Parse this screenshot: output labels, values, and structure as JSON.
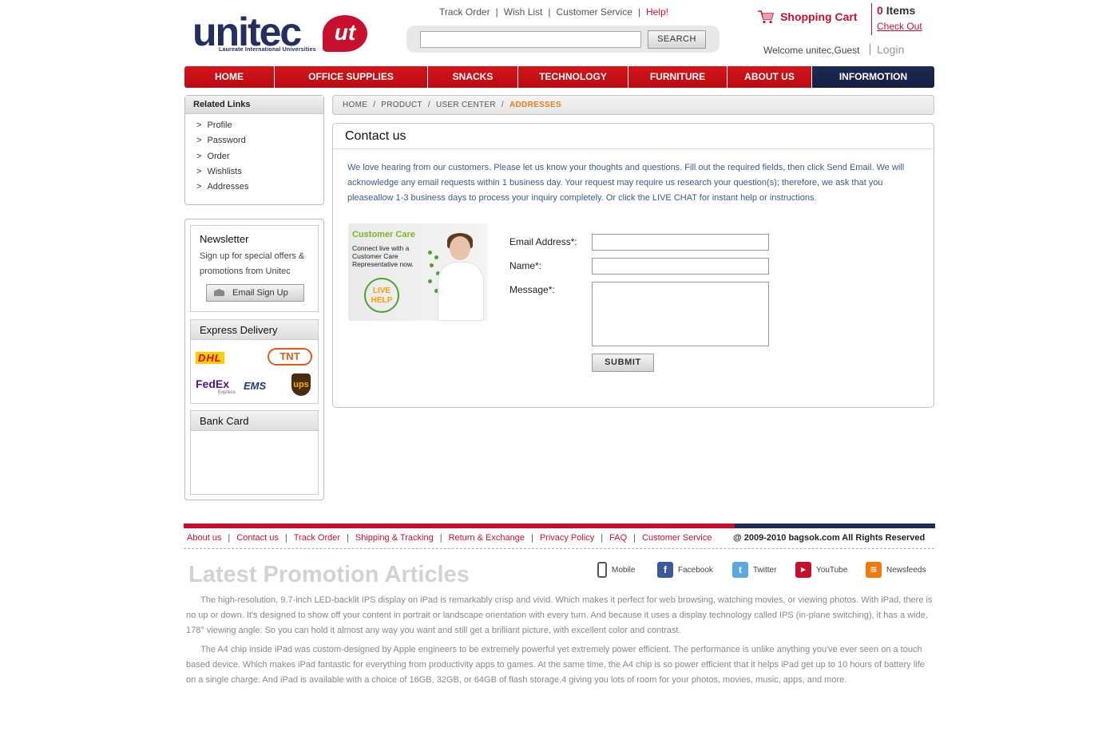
{
  "header": {
    "logo_text": "unitec",
    "logo_badge": "ut",
    "logo_sub": "Laureate International Universities",
    "top_links": [
      "Track Order",
      "Wish List",
      "Customer Service",
      "Help!"
    ],
    "search_button": "SEARCH",
    "search_value": "",
    "cart_label": "Shopping Cart",
    "cart_count": "0",
    "cart_items_word": "Items",
    "checkout": "Check Out",
    "welcome": "Welcome unitec,Guest",
    "login": "Login"
  },
  "nav": [
    "HOME",
    "OFFICE SUPPLIES",
    "SNACKS",
    "TECHNOLOGY",
    "FURNITURE",
    "ABOUT US",
    "INFORMOTION"
  ],
  "sidebar": {
    "related_title": "Related Links",
    "related_links": [
      "Profile",
      "Password",
      "Order",
      "Wishlists",
      "Addresses"
    ],
    "newsletter_title": "Newsletter",
    "newsletter_text": "Sign up for special offers & promotions from Unitec",
    "newsletter_button": "Email Sign Up",
    "express_title": "Express Delivery",
    "couriers": [
      "DHL",
      "TNT",
      "FedEx",
      "EMS",
      "ups"
    ],
    "fedex_sub": "Express",
    "bank_title": "Bank Card"
  },
  "breadcrumb": [
    "HOME",
    "PRODUCT",
    "USER CENTER",
    "ADDRESSES"
  ],
  "contact": {
    "title": "Contact us",
    "intro": "We love hearing from our customers. Please let us know your thoughts and questions. Fill out the required fields, then click Send Email. We will acknowledge any email requests within 1 business day. Your request may require us research your question(s); therefore, we ask that you pleaseallow 1-3 business days to process your inquiry completely. Or click the LIVE CHAT for instant help or instructions.",
    "care_title": "Customer Care",
    "care_text": "Connect live with a Customer Care Representative now.",
    "live_help": [
      "LIVE",
      "HELP"
    ],
    "email_label": "Email Address*:",
    "name_label": "Name*:",
    "message_label": "Message*:",
    "email_value": "",
    "name_value": "",
    "message_value": "",
    "submit": "SUBMIT"
  },
  "footer": {
    "links": [
      "About us",
      "Contact us",
      "Track Order",
      "Shipping & Tracking",
      "Return & Exchange",
      "Privacy Policy",
      "FAQ",
      "Customer Service"
    ],
    "copyright": "@ 2009-2010 bagsok.com  All Rights Reserved",
    "promo_title": "Latest Promotion Articles",
    "social": [
      "Mobile",
      "Facebook",
      "Twitter",
      "YouTube",
      "Newsfeeds"
    ],
    "para1": "The high-resolution, 9.7-inch LED-backlit IPS display on iPad is remarkably crisp and vivid. Which makes it perfect for web browsing, watching movies, or viewing photos. With iPad, there is no up or down. It's designed to show off your content in portrait or landscape orientation with every turn. And because it uses a display technology called IPS (in-plane switching), it has a wide, 178° viewing angle. So you can hold it almost any way you want and still get a brilliant picture, with excellent color and contrast.",
    "para2": "The A4 chip inside iPad was custom-designed by Apple engineers to be extremely powerful yet extremely power efficient. The performance is unlike anything you've ever seen on a touch based device. Which makes iPad fantastic for everything from productivity apps to games. At the same time, the A4 chip is so power efficient that it helps iPad get up to 10 hours of battery life on a single charge. And iPad is available with a choice of 16GB, 32GB, or 64GB of flash storage,4 giving you lots of room for your photos, movies, music, apps, and more."
  },
  "colors": {
    "brand_red": "#c8102e",
    "brand_navy": "#1d2a55",
    "crumb_active": "#e87a1e",
    "intro_text": "#3d5a8a"
  }
}
